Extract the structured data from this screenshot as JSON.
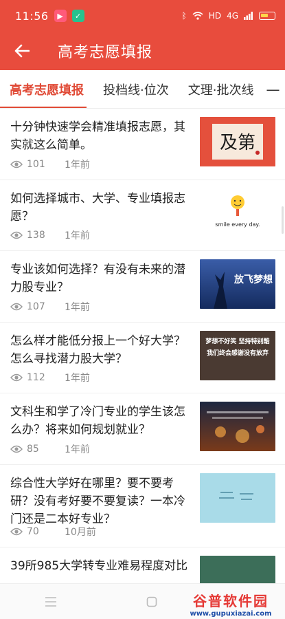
{
  "status_bar": {
    "time": "11:56",
    "network": "HD",
    "signal": "4G",
    "colors": {
      "bar": "#e84c3d"
    }
  },
  "header": {
    "title": "高考志愿填报",
    "back_icon": "arrow-left-icon"
  },
  "tabs": [
    {
      "label": "高考志愿填报",
      "active": true
    },
    {
      "label": "投档线·位次",
      "active": false
    },
    {
      "label": "文理·批次线",
      "active": false
    },
    {
      "label": "—",
      "active": false
    }
  ],
  "articles": [
    {
      "title": "十分钟快速学会精准填报志愿，其实就这么简单。",
      "views": "101",
      "time": "1年前",
      "thumb_text": "及第"
    },
    {
      "title": "如何选择城市、大学、专业填报志愿？",
      "views": "138",
      "time": "1年前",
      "thumb_text": "smile every day."
    },
    {
      "title": "专业该如何选择？有没有未来的潜力股专业？",
      "views": "107",
      "time": "1年前",
      "thumb_text": "放飞梦想"
    },
    {
      "title": "怎么样才能低分报上一个好大学？怎么寻找潜力股大学？",
      "views": "112",
      "time": "1年前",
      "thumb_text": "梦想不好笑 坚持特别酷 我们终会感谢没有放弃"
    },
    {
      "title": "文科生和学了冷门专业的学生该怎么办？将来如何规划就业？",
      "views": "85",
      "time": "1年前",
      "thumb_text": ""
    },
    {
      "title": "综合性大学好在哪里？要不要考研？没有考好要不要复读？一本冷门还是二本好专业？",
      "views": "70",
      "time": "10月前",
      "thumb_text": ""
    },
    {
      "title": "39所985大学转专业难易程度对比",
      "views": "",
      "time": "",
      "thumb_text": ""
    }
  ],
  "watermark": {
    "top": "谷普软件园",
    "bottom": "www.gupuxiazai.com"
  },
  "accent_color": "#e04a36"
}
